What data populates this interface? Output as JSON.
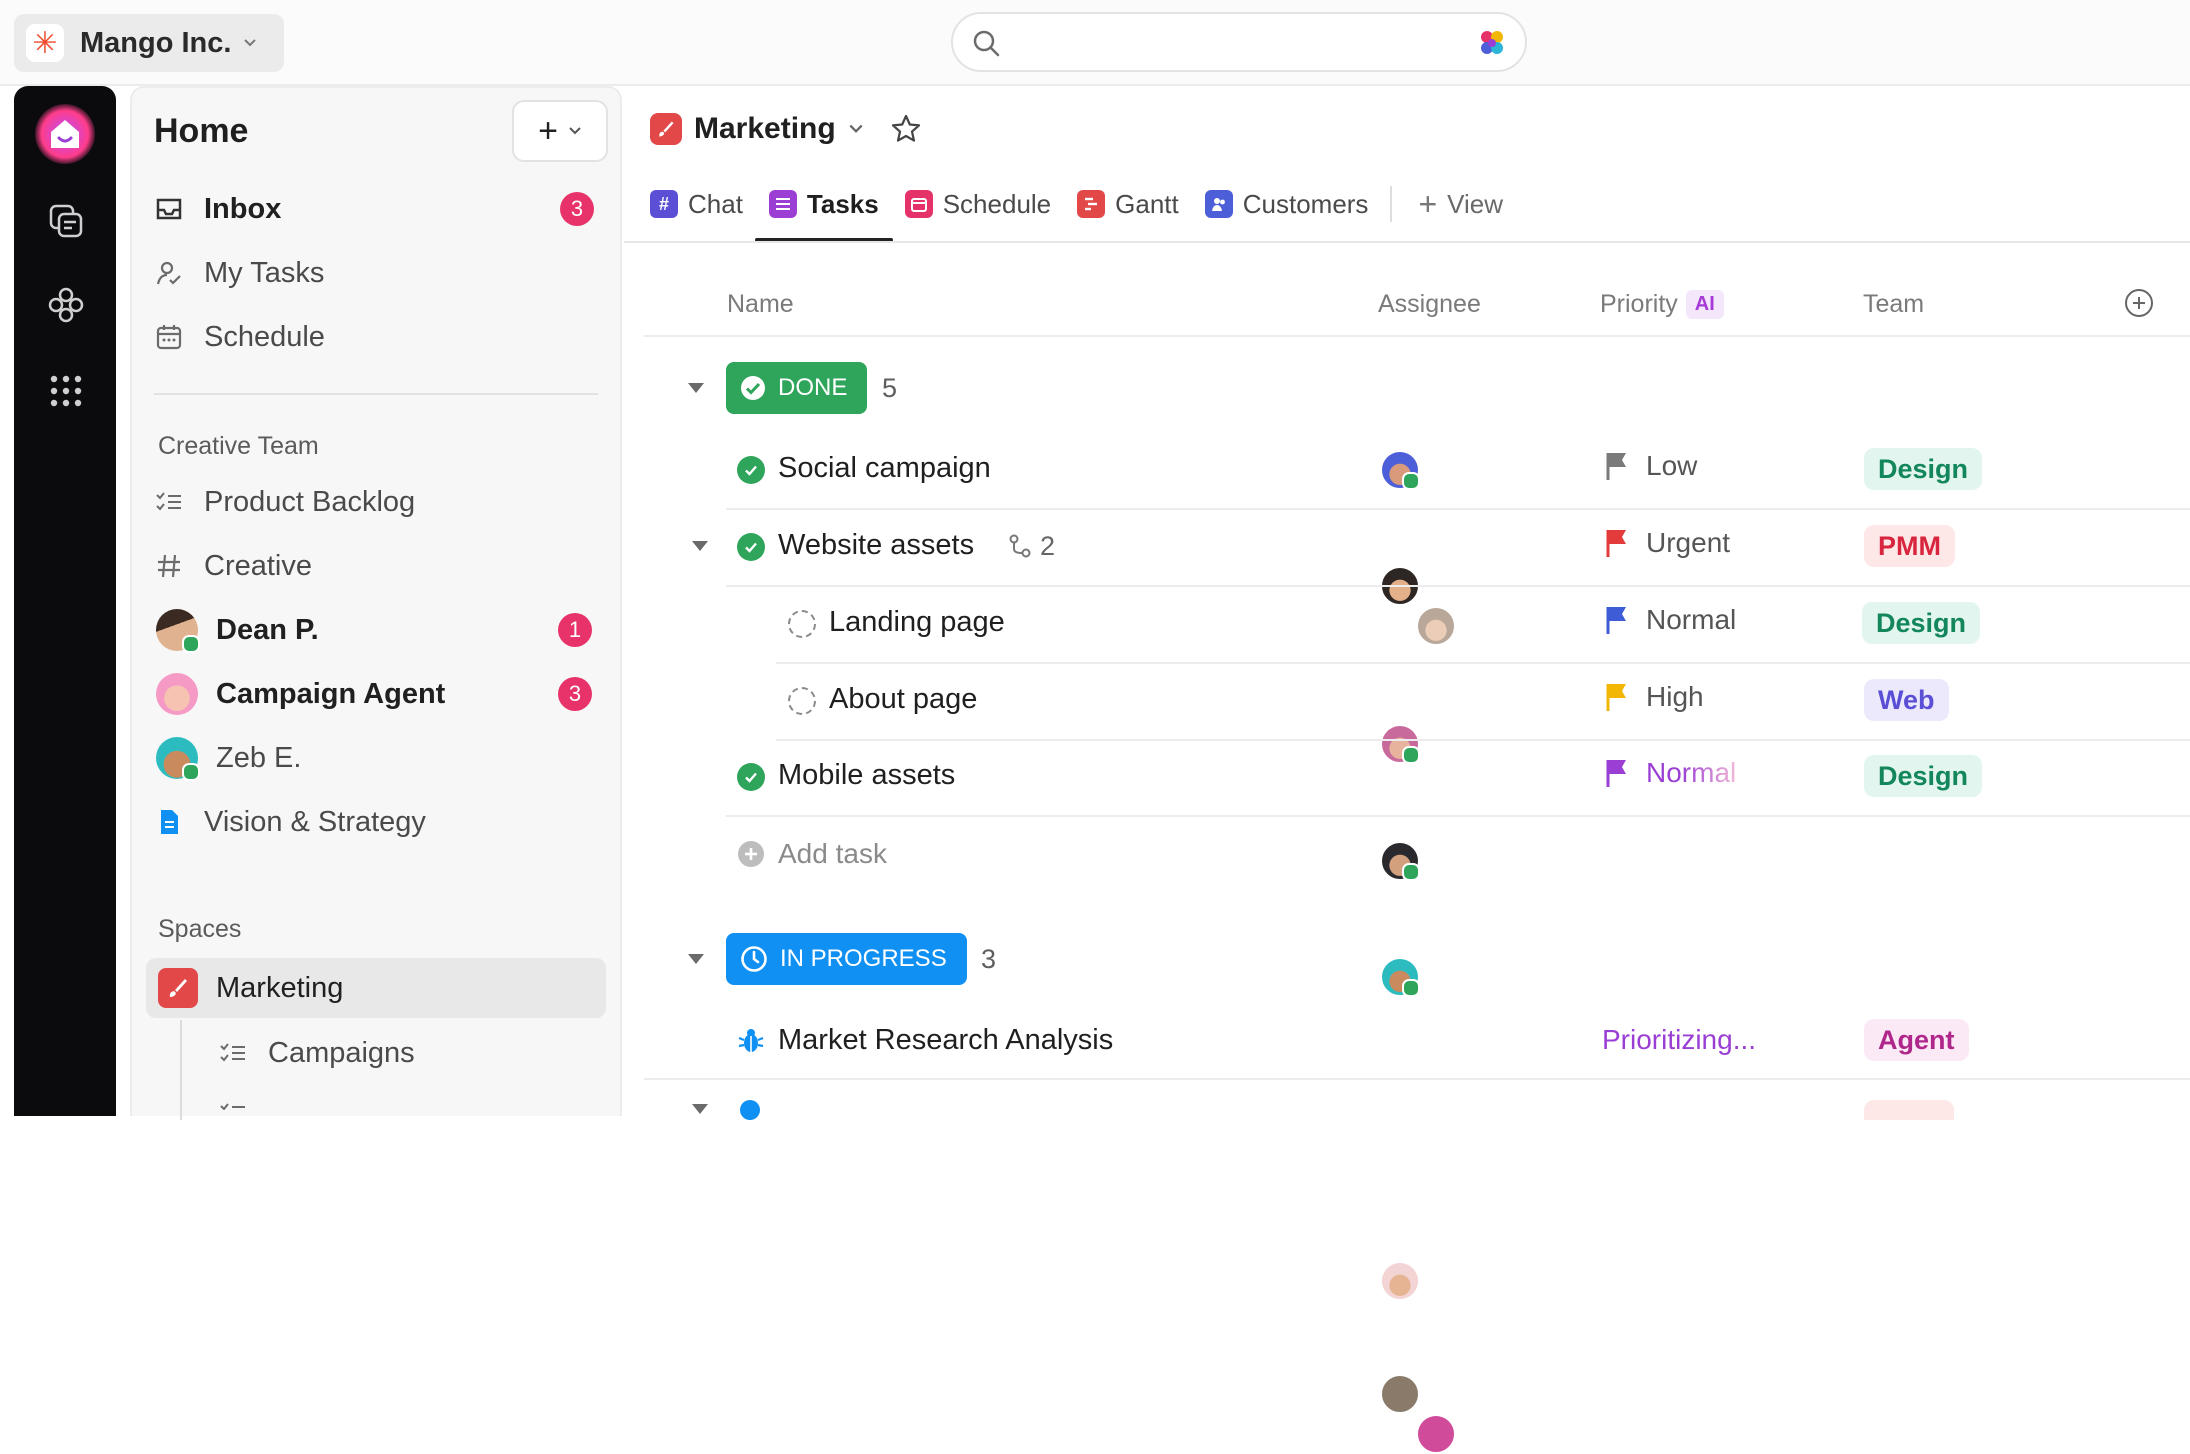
{
  "workspace": {
    "name": "Mango Inc."
  },
  "search": {
    "placeholder": ""
  },
  "sidebar": {
    "title": "Home",
    "nav": [
      {
        "label": "Inbox",
        "badge": "3"
      },
      {
        "label": "My Tasks"
      },
      {
        "label": "Schedule"
      }
    ],
    "creative_team": {
      "label": "Creative Team",
      "items": [
        {
          "label": "Product Backlog"
        },
        {
          "label": "Creative"
        },
        {
          "label": "Dean P.",
          "badge": "1"
        },
        {
          "label": "Campaign Agent",
          "badge": "3"
        },
        {
          "label": "Zeb E."
        },
        {
          "label": "Vision & Strategy"
        }
      ]
    },
    "spaces": {
      "label": "Spaces",
      "items": [
        {
          "label": "Marketing"
        },
        {
          "label": "Campaigns"
        }
      ]
    }
  },
  "main": {
    "title": "Marketing",
    "tabs": [
      {
        "label": "Chat",
        "color": "#5b4fd6"
      },
      {
        "label": "Tasks",
        "color": "#9b3fd4"
      },
      {
        "label": "Schedule",
        "color": "#e5336a"
      },
      {
        "label": "Gantt",
        "color": "#e24848"
      },
      {
        "label": "Customers",
        "color": "#4c5fd8"
      }
    ],
    "add_view": "View",
    "columns": {
      "name": "Name",
      "assignee": "Assignee",
      "priority": "Priority",
      "priority_ai": "AI",
      "team": "Team"
    },
    "groups": [
      {
        "status": "DONE",
        "count": "5",
        "color": "#2ea55a",
        "tasks": [
          {
            "name": "Social campaign",
            "priority": "Low",
            "team": "Design"
          },
          {
            "name": "Website assets",
            "subtasks": "2",
            "priority": "Urgent",
            "team": "PMM"
          },
          {
            "name": "Landing page",
            "priority": "Normal",
            "team": "Design"
          },
          {
            "name": "About page",
            "priority": "High",
            "team": "Web"
          },
          {
            "name": "Mobile assets",
            "priority": "Normal",
            "team": "Design"
          }
        ],
        "add_task": "Add task"
      },
      {
        "status": "IN PROGRESS",
        "count": "3",
        "color": "#1090f2",
        "tasks": [
          {
            "name": "Market Research Analysis",
            "priority": "Prioritizing...",
            "team": "Agent"
          }
        ]
      }
    ]
  },
  "colors": {
    "priority_low": "#7a7a7a",
    "priority_urgent": "#e33b3b",
    "priority_normal": "#3e5cd6",
    "priority_high": "#f2b705",
    "priority_ai": "#9b3fd4",
    "tag_design_bg": "#e2f5ee",
    "tag_design_fg": "#13875b",
    "tag_pmm_bg": "#fde7e7",
    "tag_pmm_fg": "#d7263d",
    "tag_web_bg": "#ebe9fb",
    "tag_web_fg": "#5b4fd6",
    "tag_agent_bg": "#fbe9f6",
    "tag_agent_fg": "#b0278c"
  }
}
